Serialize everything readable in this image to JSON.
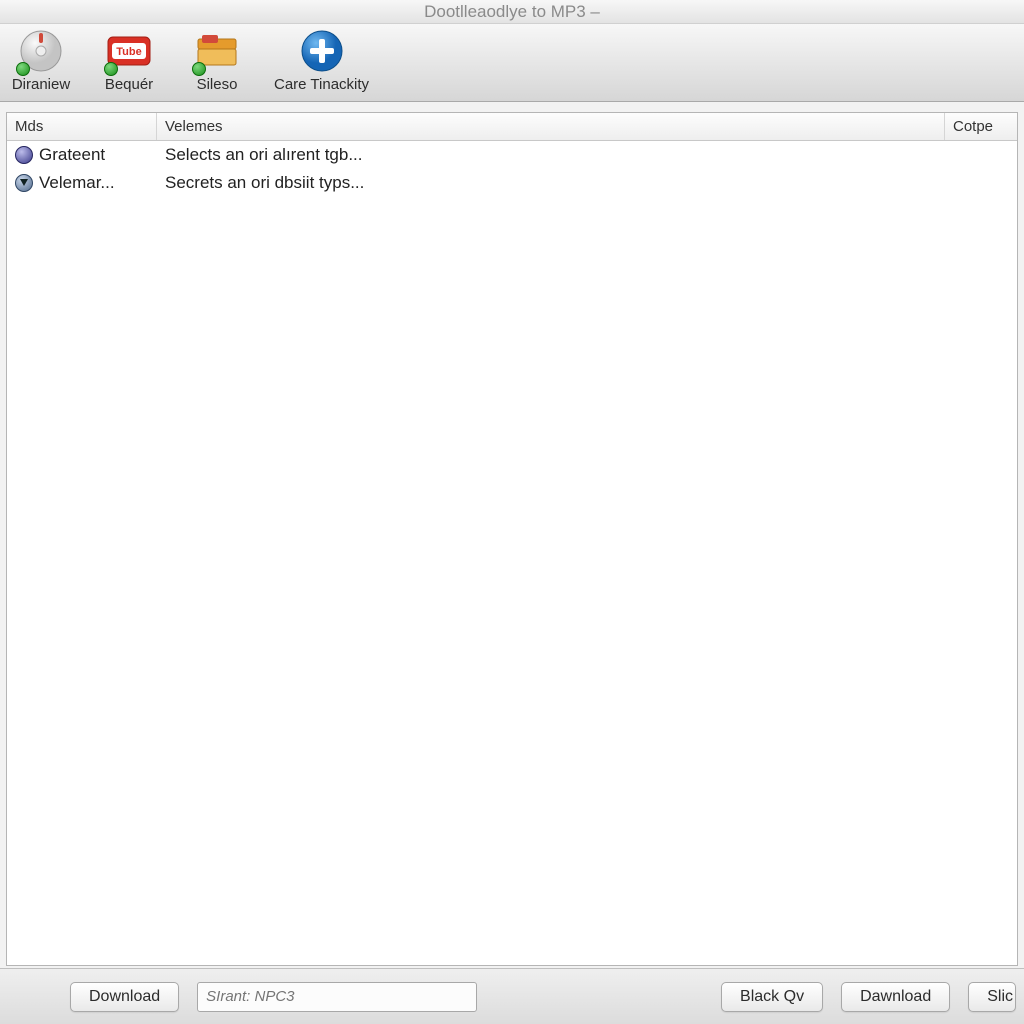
{
  "title": "Dootlleaodlye to MP3 –",
  "toolbar": [
    {
      "label": "Diraniew",
      "icon": "disc"
    },
    {
      "label": "Bequér",
      "icon": "tube"
    },
    {
      "label": "Sileso",
      "icon": "folder"
    },
    {
      "label": "Care Tinackity",
      "icon": "plus"
    }
  ],
  "columns": [
    "Mds",
    "Velemes",
    "Cotpe"
  ],
  "rows": [
    {
      "icon": "globe",
      "c0": "Grateent",
      "c1": "Selects an ori alırent tgb...",
      "c2": ""
    },
    {
      "icon": "down",
      "c0": "Velemar...",
      "c1": "Secrets an ori dbsiit typs...",
      "c2": ""
    }
  ],
  "bottom": {
    "download_left": "Download",
    "input_placeholder": "SIrant: NPC3",
    "black_qv": "Black Qv",
    "download_right": "Dawnload",
    "slic": "Slic"
  }
}
